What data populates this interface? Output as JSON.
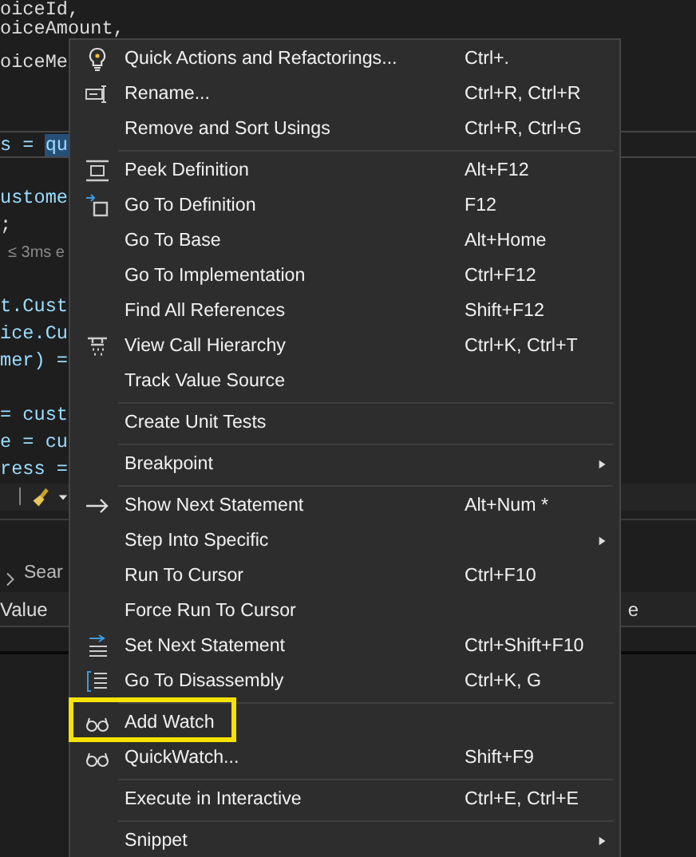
{
  "editor": {
    "lines": [
      {
        "kind": "plain",
        "text": "oiceId,"
      },
      {
        "kind": "plain",
        "text": "oiceAmount,"
      },
      {
        "kind": "plain",
        "text": "oiceMe"
      },
      {
        "kind": "blank"
      },
      {
        "kind": "blank"
      },
      {
        "kind": "current",
        "text": "s = ",
        "selection": "qu"
      },
      {
        "kind": "blank"
      },
      {
        "kind": "ident",
        "text": "ustome"
      },
      {
        "kind": "plain",
        "text": ";"
      },
      {
        "kind": "hint",
        "text": "≤ 3ms e"
      },
      {
        "kind": "blank"
      },
      {
        "kind": "ident",
        "text": "t.Cust"
      },
      {
        "kind": "ident",
        "text": "ice.Cu"
      },
      {
        "kind": "ident",
        "text": "mer) ="
      },
      {
        "kind": "blank"
      },
      {
        "kind": "ident",
        "text": "= cust"
      },
      {
        "kind": "ident",
        "text": "e = cu"
      },
      {
        "kind": "ident",
        "text": "ress ="
      },
      {
        "kind": "toolbar",
        "text": "|"
      }
    ]
  },
  "panel": {
    "search_label": "Sear",
    "columns": [
      "Value",
      "e"
    ]
  },
  "context_menu": {
    "items": [
      {
        "kind": "item",
        "label": "Quick Actions and Refactorings...",
        "shortcut": "Ctrl+.",
        "submenu": false,
        "highlighted": false
      },
      {
        "kind": "item",
        "label": "Rename...",
        "shortcut": "Ctrl+R, Ctrl+R",
        "submenu": false,
        "highlighted": false
      },
      {
        "kind": "item",
        "label": "Remove and Sort Usings",
        "shortcut": "Ctrl+R, Ctrl+G",
        "submenu": false,
        "highlighted": false
      },
      {
        "kind": "separator"
      },
      {
        "kind": "item",
        "label": "Peek Definition",
        "shortcut": "Alt+F12",
        "submenu": false,
        "highlighted": false
      },
      {
        "kind": "item",
        "label": "Go To Definition",
        "shortcut": "F12",
        "submenu": false,
        "highlighted": false
      },
      {
        "kind": "item",
        "label": "Go To Base",
        "shortcut": "Alt+Home",
        "submenu": false,
        "highlighted": false
      },
      {
        "kind": "item",
        "label": "Go To Implementation",
        "shortcut": "Ctrl+F12",
        "submenu": false,
        "highlighted": false
      },
      {
        "kind": "item",
        "label": "Find All References",
        "shortcut": "Shift+F12",
        "submenu": false,
        "highlighted": false
      },
      {
        "kind": "item",
        "label": "View Call Hierarchy",
        "shortcut": "Ctrl+K, Ctrl+T",
        "submenu": false,
        "highlighted": false
      },
      {
        "kind": "item",
        "label": "Track Value Source",
        "submenu": false,
        "highlighted": false
      },
      {
        "kind": "separator"
      },
      {
        "kind": "item",
        "label": "Create Unit Tests",
        "submenu": false,
        "highlighted": false
      },
      {
        "kind": "separator"
      },
      {
        "kind": "item",
        "label": "Breakpoint",
        "submenu": true,
        "highlighted": false
      },
      {
        "kind": "separator"
      },
      {
        "kind": "item",
        "label": "Show Next Statement",
        "shortcut": "Alt+Num *",
        "submenu": false,
        "highlighted": false
      },
      {
        "kind": "item",
        "label": "Step Into Specific",
        "submenu": true,
        "highlighted": false
      },
      {
        "kind": "item",
        "label": "Run To Cursor",
        "shortcut": "Ctrl+F10",
        "submenu": false,
        "highlighted": false
      },
      {
        "kind": "item",
        "label": "Force Run To Cursor",
        "submenu": false,
        "highlighted": false
      },
      {
        "kind": "item",
        "label": "Set Next Statement",
        "shortcut": "Ctrl+Shift+F10",
        "submenu": false,
        "highlighted": false
      },
      {
        "kind": "item",
        "label": "Go To Disassembly",
        "shortcut": "Ctrl+K, G",
        "submenu": false,
        "highlighted": false
      },
      {
        "kind": "separator"
      },
      {
        "kind": "item",
        "label": "Add Watch",
        "submenu": false,
        "highlighted": true
      },
      {
        "kind": "item",
        "label": "QuickWatch...",
        "shortcut": "Shift+F9",
        "submenu": false,
        "highlighted": false
      },
      {
        "kind": "separator"
      },
      {
        "kind": "item",
        "label": "Execute in Interactive",
        "shortcut": "Ctrl+E, Ctrl+E",
        "submenu": false,
        "highlighted": false
      },
      {
        "kind": "separator"
      },
      {
        "kind": "item",
        "label": "Snippet",
        "submenu": true,
        "highlighted": false
      }
    ]
  }
}
